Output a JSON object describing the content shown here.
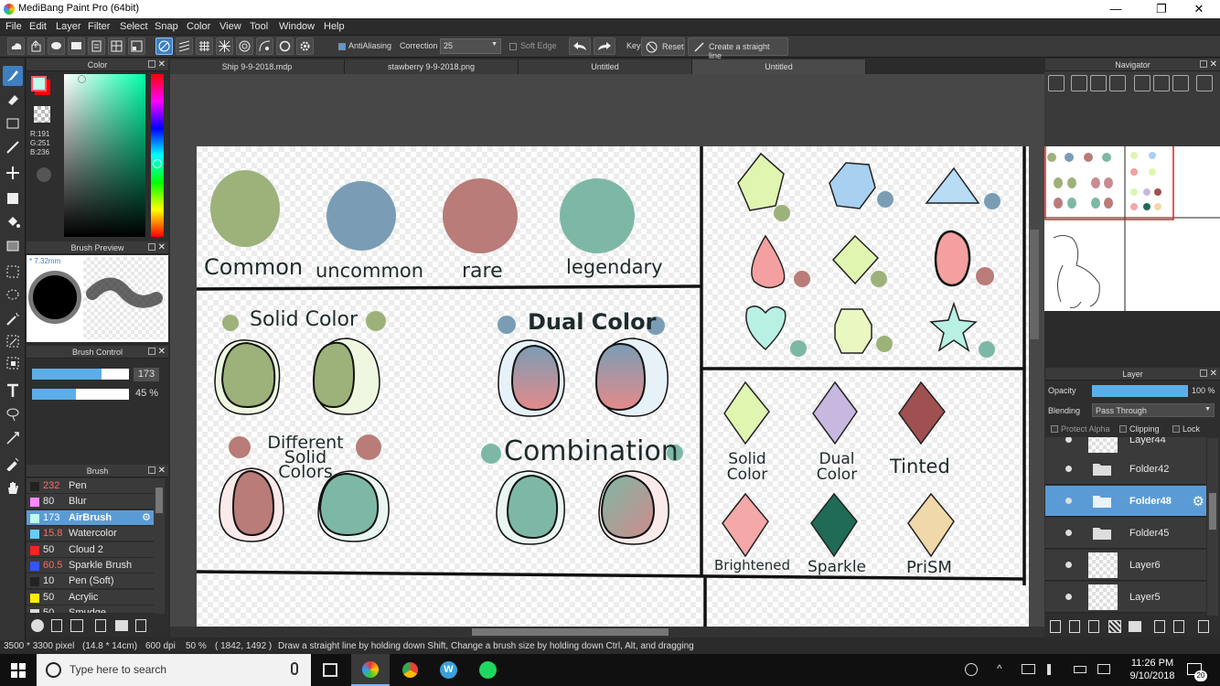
{
  "window": {
    "title": "MediBang Paint Pro (64bit)",
    "minimize": "—",
    "maximize": "❐",
    "close": "✕"
  },
  "menu": [
    "File",
    "Edit",
    "Layer",
    "Filter",
    "Select",
    "Snap",
    "Color",
    "View",
    "Tool",
    "Window",
    "Help"
  ],
  "toolbar": {
    "antialiasing": "AntiAliasing",
    "correction_label": "Correction",
    "correction_value": "25",
    "soft_edge": "Soft Edge",
    "key_label": "Key",
    "reset": "Reset",
    "straight_line": "Create a straight line"
  },
  "color_panel": {
    "title": "Color",
    "r": "R:191",
    "g": "G:251",
    "b": "B:236",
    "primary": "#bffbec",
    "secondary": "#ff0000"
  },
  "brush_preview": {
    "title": "Brush Preview",
    "size": "* 7.32mm"
  },
  "brush_control": {
    "title": "Brush Control",
    "size_value": "173",
    "size_fraction": 0.72,
    "opacity_value": "45 %",
    "opacity_fraction": 0.45
  },
  "brush_panel": {
    "title": "Brush",
    "items": [
      {
        "size": "232",
        "name": "Pen",
        "color": "#222222",
        "size_color": "#ff6a6a"
      },
      {
        "size": "80",
        "name": "Blur",
        "color": "#ff88ff",
        "size_color": "#e8e8e8"
      },
      {
        "size": "173",
        "name": "AirBrush",
        "color": "#bffbec",
        "size_color": "#ffffff",
        "selected": true
      },
      {
        "size": "15.8",
        "name": "Watercolor",
        "color": "#66ccff",
        "size_color": "#ff6a6a"
      },
      {
        "size": "50",
        "name": "Cloud 2",
        "color": "#ff2222",
        "size_color": "#e8e8e8"
      },
      {
        "size": "60.5",
        "name": "Sparkle Brush",
        "color": "#3355ff",
        "size_color": "#ff6a6a"
      },
      {
        "size": "10",
        "name": "Pen (Soft)",
        "color": "#222222",
        "size_color": "#e8e8e8"
      },
      {
        "size": "50",
        "name": "Acrylic",
        "color": "#ffee00",
        "size_color": "#e8e8e8"
      },
      {
        "size": "50",
        "name": "Smudge",
        "color": "#dddddd",
        "size_color": "#e8e8e8"
      }
    ]
  },
  "tabs": [
    {
      "label": "Ship 9-9-2018.mdp"
    },
    {
      "label": "stawberry 9-9-2018.png"
    },
    {
      "label": "Untitled"
    },
    {
      "label": "Untitled",
      "active": true
    }
  ],
  "canvas": {
    "rarity": [
      {
        "label": "Common",
        "color": "#9db27a"
      },
      {
        "label": "uncommon",
        "color": "#7a9db5"
      },
      {
        "label": "rare",
        "color": "#b97c78"
      },
      {
        "label": "legendary",
        "color": "#7db8a6"
      }
    ],
    "solid_color": "Solid Color",
    "dual_color": "Dual Color",
    "different_solid_colors": "Different Solid Colors",
    "combination": "Combination",
    "styles": [
      "Solid Color",
      "Dual Color",
      "Tinted",
      "Brightened",
      "Sparkle",
      "PriSM"
    ]
  },
  "navigator": {
    "title": "Navigator"
  },
  "layer_panel": {
    "title": "Layer",
    "opacity_label": "Opacity",
    "opacity_value": "100 %",
    "blending_label": "Blending",
    "blending_value": "Pass Through",
    "protect_alpha": "Protect Alpha",
    "clipping": "Clipping",
    "lock": "Lock",
    "layers": [
      {
        "name": "Layer44",
        "type": "layer"
      },
      {
        "name": "Folder42",
        "type": "folder"
      },
      {
        "name": "Folder48",
        "type": "folder",
        "selected": true
      },
      {
        "name": "Folder45",
        "type": "folder"
      },
      {
        "name": "Layer6",
        "type": "layer"
      },
      {
        "name": "Layer5",
        "type": "layer"
      }
    ]
  },
  "status": {
    "dimensions": "3500 * 3300 pixel",
    "size": "(14.8 * 14cm)",
    "dpi": "600 dpi",
    "zoom": "50 %",
    "coords": "( 1842, 1492 )",
    "hint": "Draw a straight line by holding down Shift, Change a brush size by holding down Ctrl, Alt, and dragging"
  },
  "taskbar": {
    "search_placeholder": "Type here to search",
    "time": "11:26 PM",
    "date": "9/10/2018",
    "notifications": "20"
  }
}
